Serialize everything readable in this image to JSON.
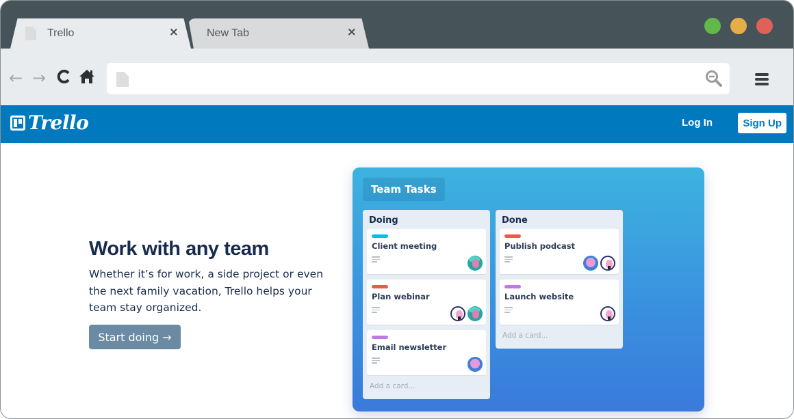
{
  "browser": {
    "tabs": [
      {
        "label": "Trello",
        "active": true,
        "close_icon": "×"
      },
      {
        "label": "New Tab",
        "active": false,
        "close_icon": "×"
      }
    ],
    "window_controls": [
      {
        "name": "maximize",
        "color": "#62b94a"
      },
      {
        "name": "minimize",
        "color": "#e6ae47"
      },
      {
        "name": "close",
        "color": "#e0615a"
      }
    ],
    "nav": {
      "back_icon": "←",
      "forward_icon": "→",
      "reload_icon": "C",
      "home_icon": "⌂"
    },
    "address_bar": {
      "value": "",
      "placeholder": ""
    }
  },
  "site": {
    "brand_color": "#0079bf",
    "logo_text": "Trello",
    "login_label": "Log In",
    "signup_label": "Sign Up"
  },
  "hero": {
    "title": "Work with any team",
    "body": "Whether it’s for work, a side project or even the next family vacation, Trello helps your team stay organized.",
    "cta_label": "Start doing →"
  },
  "board": {
    "title": "Team Tasks",
    "lists": [
      {
        "title": "Doing",
        "add_card": "Add a card...",
        "cards": [
          {
            "title": "Client meeting",
            "label_color": "#00c2e0",
            "avatars": [
              "teal"
            ]
          },
          {
            "title": "Plan webinar",
            "label_color": "#eb5a46",
            "avatars": [
              "outline",
              "teal"
            ]
          },
          {
            "title": "Email newsletter",
            "label_color": "#c377e0",
            "avatars": [
              "pink"
            ]
          }
        ]
      },
      {
        "title": "Done",
        "add_card": "Add a card...",
        "cards": [
          {
            "title": "Publish podcast",
            "label_color": "#eb5a46",
            "avatars": [
              "pink",
              "outline"
            ]
          },
          {
            "title": "Launch website",
            "label_color": "#c377e0",
            "avatars": [
              "outline"
            ]
          }
        ]
      }
    ]
  }
}
